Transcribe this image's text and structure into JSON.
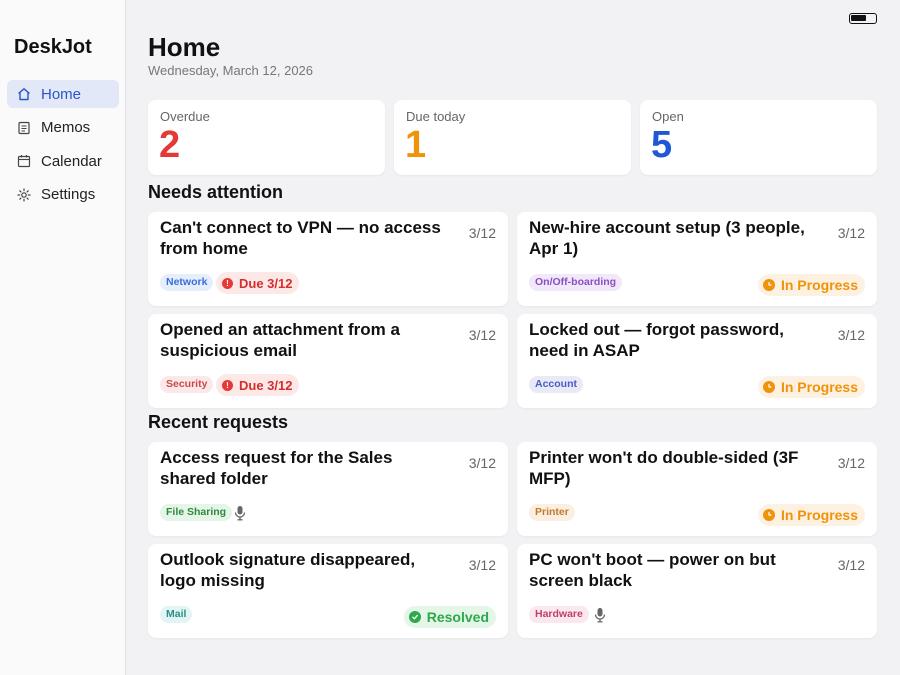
{
  "app": {
    "title": "DeskJot"
  },
  "sidebar": {
    "items": [
      {
        "label": "Home",
        "icon": "home-icon",
        "active": true
      },
      {
        "label": "Memos",
        "icon": "memo-icon",
        "active": false
      },
      {
        "label": "Calendar",
        "icon": "calendar-icon",
        "active": false
      },
      {
        "label": "Settings",
        "icon": "settings-icon",
        "active": false
      }
    ]
  },
  "header": {
    "title": "Home",
    "date": "Wednesday, March 12, 2026"
  },
  "stats": [
    {
      "label": "Overdue",
      "value": "2",
      "color": "#e53935"
    },
    {
      "label": "Due today",
      "value": "1",
      "color": "#f0920a"
    },
    {
      "label": "Open",
      "value": "5",
      "color": "#1f57d6"
    }
  ],
  "sections": {
    "attention": "Needs attention",
    "recent": "Recent requests"
  },
  "attention_cards": [
    {
      "title": "Can't connect to VPN — no access from home",
      "date": "3/12",
      "tag": "Network",
      "tag_color": "#3a6fd8",
      "tag_bg": "#e6eefc",
      "due": "Due 3/12"
    },
    {
      "title": "New-hire account setup (3 people, Apr 1)",
      "date": "3/12",
      "tag": "On/Off-boarding",
      "tag_color": "#8a4fc0",
      "tag_bg": "#f1e8fa",
      "status": "In Progress"
    },
    {
      "title": "Opened an attachment from a suspicious email",
      "date": "3/12",
      "tag": "Security",
      "tag_color": "#c94a4a",
      "tag_bg": "#fbe9e9",
      "due": "Due 3/12"
    },
    {
      "title": "Locked out — forgot password, need in ASAP",
      "date": "3/12",
      "tag": "Account",
      "tag_color": "#4a5cc0",
      "tag_bg": "#e8eaf8",
      "status": "In Progress"
    }
  ],
  "recent_cards": [
    {
      "title": "Access request for the Sales shared folder",
      "date": "3/12",
      "tag": "File Sharing",
      "tag_color": "#2f8a3e",
      "tag_bg": "#e5f5e8",
      "voice_memo": true
    },
    {
      "title": "Printer won't do double-sided (3F MFP)",
      "date": "3/12",
      "tag": "Printer",
      "tag_color": "#c07a2a",
      "tag_bg": "#fbefe2",
      "status": "In Progress"
    },
    {
      "title": "Outlook signature disappeared, logo missing",
      "date": "3/12",
      "tag": "Mail",
      "tag_color": "#2a8f88",
      "tag_bg": "#e2f4f3",
      "resolved": "Resolved"
    },
    {
      "title": "PC won't boot — power on but screen black",
      "date": "3/12",
      "tag": "Hardware",
      "tag_color": "#c0406a",
      "tag_bg": "#fbe7ee",
      "voice_memo": true
    }
  ]
}
